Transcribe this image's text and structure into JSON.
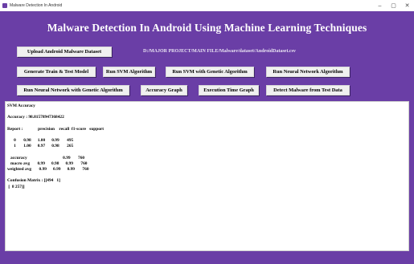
{
  "window": {
    "title": "Malware Detection In Android",
    "minimize": "–",
    "maximize": "▢",
    "close": "✕"
  },
  "app": {
    "heading": "Malware Detection In Android Using Machine Learning Techniques",
    "dataset_path": "D:/MAJOR PROJECT/MAIN FILE/Malware/dataset/AndroidDataset.csv",
    "buttons": {
      "upload": "Upload Android Malware Dataset",
      "generate": "Generate Train & Test Model",
      "run_svm": "Run SVM Algorithm",
      "run_svm_ga": "Run SVM with Genetic Algorithm",
      "run_nn": "Run Neural Network Algorithm",
      "run_nn_ga": "Run Neural Network with Genetic Algorithm",
      "accuracy_graph": "Accuracy Graph",
      "exec_graph": "Execution Time Graph",
      "detect": "Detect Malware from Test Data"
    },
    "colors": {
      "background": "#6a3ea6",
      "button": "#f0f0f0"
    }
  },
  "output": {
    "lines": [
      "SVM Accuracy",
      "",
      "Accuracy : 98.81578947368422",
      "",
      "Report :              precision    recall  f1-score   support",
      "",
      "      0       0.98      1.00      0.99       495",
      "      1       1.00      0.97      0.98       265",
      "",
      "   accuracy                                 0.99       760",
      "   macro avg       0.99      0.98      0.99       760",
      "weighted avg       0.99      0.99      0.99       760",
      "",
      "Confusion Matrix : [[494   1]",
      " [  8 257]]"
    ]
  }
}
